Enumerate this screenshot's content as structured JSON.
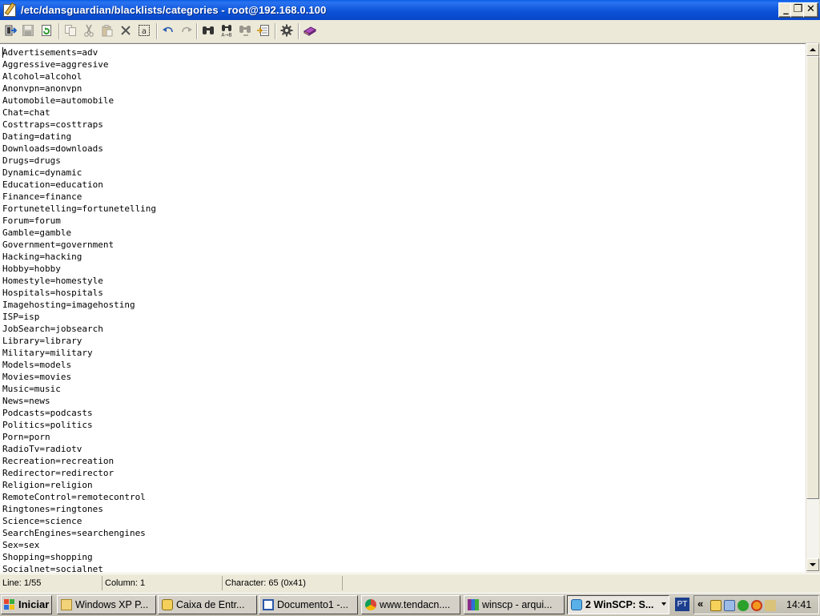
{
  "window": {
    "title": "/etc/dansguardian/blacklists/categories - root@192.168.0.100",
    "controls": {
      "minimize": "_",
      "maximize": "❐",
      "close": "✕"
    }
  },
  "toolbar": {
    "buttons": [
      "exit-icon",
      "save-icon",
      "reload-icon",
      "copy-icon",
      "cut-icon",
      "paste-icon",
      "delete-icon",
      "select-all-icon",
      "undo-icon",
      "redo-icon",
      "find-icon",
      "replace-icon",
      "find-next-icon",
      "goto-line-icon",
      "settings-icon",
      "help-icon"
    ]
  },
  "editor": {
    "lines": [
      "Advertisements=adv",
      "Aggressive=aggresive",
      "Alcohol=alcohol",
      "Anonvpn=anonvpn",
      "Automobile=automobile",
      "Chat=chat",
      "Costtraps=costtraps",
      "Dating=dating",
      "Downloads=downloads",
      "Drugs=drugs",
      "Dynamic=dynamic",
      "Education=education",
      "Finance=finance",
      "Fortunetelling=fortunetelling",
      "Forum=forum",
      "Gamble=gamble",
      "Government=government",
      "Hacking=hacking",
      "Hobby=hobby",
      "Homestyle=homestyle",
      "Hospitals=hospitals",
      "Imagehosting=imagehosting",
      "ISP=isp",
      "JobSearch=jobsearch",
      "Library=library",
      "Military=military",
      "Models=models",
      "Movies=movies",
      "Music=music",
      "News=news",
      "Podcasts=podcasts",
      "Politics=politics",
      "Porn=porn",
      "RadioTv=radiotv",
      "Recreation=recreation",
      "Redirector=redirector",
      "Religion=religion",
      "RemoteControl=remotecontrol",
      "Ringtones=ringtones",
      "Science=science",
      "SearchEngines=searchengines",
      "Sex=sex",
      "Shopping=shopping",
      "Socialnet=socialnet"
    ]
  },
  "status": {
    "line": "Line: 1/55",
    "column": "Column: 1",
    "character": "Character: 65 (0x41)"
  },
  "taskbar": {
    "start": "Iniciar",
    "tasks": [
      {
        "label": "Windows XP P...",
        "icon": "folder-icon",
        "active": false
      },
      {
        "label": "Caixa de Entr...",
        "icon": "mail-icon",
        "active": false
      },
      {
        "label": "Documento1 -...",
        "icon": "word-icon",
        "active": false
      },
      {
        "label": "www.tendacn....",
        "icon": "chrome-icon",
        "active": false
      },
      {
        "label": "winscp - arqui...",
        "icon": "winrar-icon",
        "active": false
      },
      {
        "label": "2 WinSCP: S...",
        "icon": "winscp-icon",
        "active": true
      }
    ],
    "language": "PT",
    "chevron": "«",
    "clock": "14:41"
  }
}
